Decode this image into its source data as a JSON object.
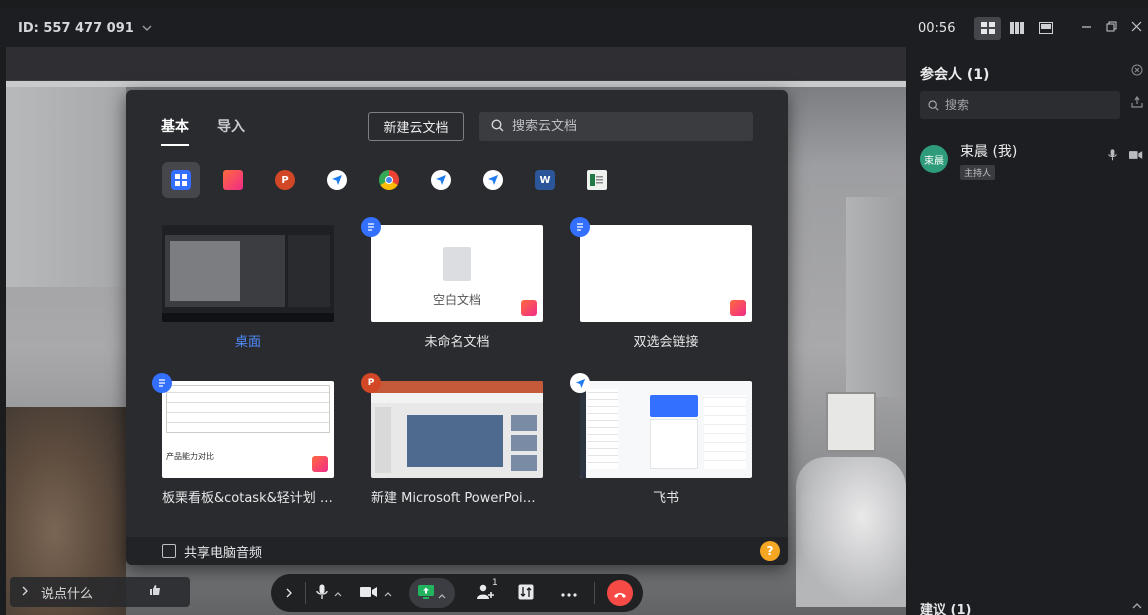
{
  "top_bar": {
    "meeting_id": "ID: 557 477 091",
    "timer": "00:56",
    "window_controls": [
      "minimize-icon",
      "restore-icon",
      "close-icon"
    ]
  },
  "dialog": {
    "tabs": [
      {
        "label": "基本",
        "active": true
      },
      {
        "label": "导入",
        "active": false
      }
    ],
    "new_doc_button": "新建云文档",
    "search_placeholder": "搜索云文档",
    "apps": [
      {
        "icon": "all-windows-icon",
        "active": true
      },
      {
        "icon": "feishu-whiteboard-icon"
      },
      {
        "icon": "powerpoint-icon"
      },
      {
        "icon": "feishu-icon"
      },
      {
        "icon": "chrome-icon"
      },
      {
        "icon": "feishu-icon"
      },
      {
        "icon": "feishu-icon"
      },
      {
        "icon": "word-icon"
      },
      {
        "icon": "sheet-window-icon"
      }
    ],
    "items": [
      {
        "label": "桌面",
        "selected": true
      },
      {
        "label": "未命名文档",
        "thumb_text": "空白文档"
      },
      {
        "label": "双选会链接"
      },
      {
        "label": "板栗看板&cotask&轻计划 差...",
        "thumb_text": "产品能力对比"
      },
      {
        "label": "新建 Microsoft PowerPoint 演..."
      },
      {
        "label": "飞书"
      }
    ],
    "share_audio_label": "共享电脑音频",
    "help": "?"
  },
  "toolbar": {
    "chat_placeholder": "说点什么",
    "participants_count": "1"
  },
  "panel": {
    "title": "参会人 (1)",
    "search_placeholder": "搜索",
    "participant": {
      "avatar_text": "束晨",
      "name": "束晨 (我)",
      "role": "主持人"
    },
    "suggestions": "建议 (1)"
  },
  "colors": {
    "accent": "#3370ff",
    "hangup": "#f54a45",
    "share_green": "#22b35e",
    "avatar": "#2e9c7a"
  }
}
